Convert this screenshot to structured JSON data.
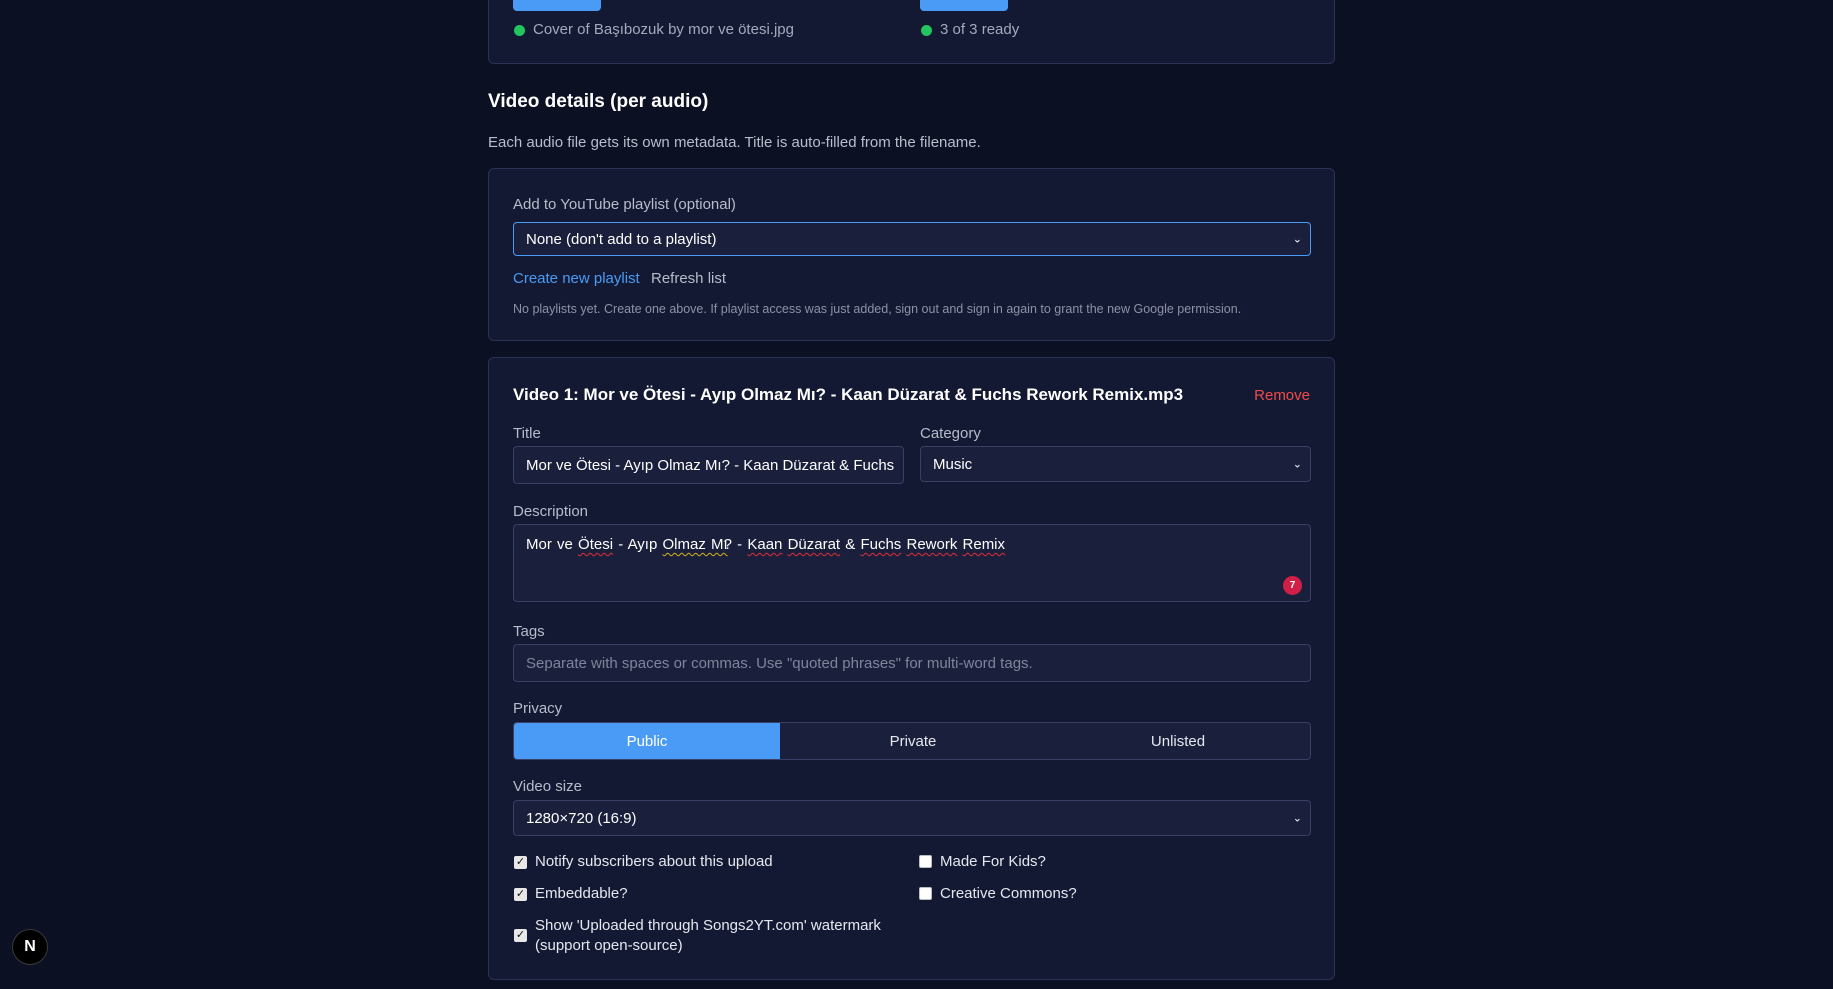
{
  "upload_status": {
    "cover_file": "Cover of Başıbozuk by mor ve ötesi.jpg",
    "ready_text": "3 of 3 ready",
    "status_color": "#22c55e"
  },
  "video_details": {
    "heading": "Video details (per audio)",
    "subtitle": "Each audio file gets its own metadata. Title is auto-filled from the filename."
  },
  "playlist": {
    "label": "Add to YouTube playlist (optional)",
    "selected": "None (don't add to a playlist)",
    "create_link": "Create new playlist",
    "refresh_link": "Refresh list",
    "note": "No playlists yet. Create one above. If playlist access was just added, sign out and sign in again to grant the new Google permission."
  },
  "video": {
    "heading": "Video 1: Mor ve Ötesi - Ayıp Olmaz Mı? - Kaan Düzarat & Fuchs Rework Remix.mp3",
    "remove_label": "Remove",
    "title_label": "Title",
    "title_value": "Mor ve Ötesi - Ayıp Olmaz Mı? - Kaan Düzarat & Fuchs",
    "category_label": "Category",
    "category_value": "Music",
    "description_label": "Description",
    "description_words": [
      "Mor",
      "ve",
      "Ötesi",
      "-",
      "Ayıp",
      "Olmaz Mı",
      "?",
      "-",
      "Kaan",
      "Düzarat",
      "&",
      "Fuchs",
      "Rework",
      "Remix"
    ],
    "spell_badge_count": "7",
    "tags_label": "Tags",
    "tags_placeholder": "Separate with spaces or commas. Use \"quoted phrases\" for multi-word tags.",
    "privacy_label": "Privacy",
    "privacy_options": [
      "Public",
      "Private",
      "Unlisted"
    ],
    "privacy_selected": "Public",
    "video_size_label": "Video size",
    "video_size_value": "1280×720 (16:9)",
    "options": {
      "notify": {
        "label": "Notify subscribers about this upload",
        "checked": true
      },
      "embeddable": {
        "label": "Embeddable?",
        "checked": true
      },
      "watermark": {
        "label_line1": "Show 'Uploaded through Songs2YT.com' watermark",
        "label_line2": "(support open-source)",
        "checked": true
      },
      "made_for_kids": {
        "label": "Made For Kids?",
        "checked": false
      },
      "creative_commons": {
        "label": "Creative Commons?",
        "checked": false
      }
    }
  },
  "colors": {
    "accent": "#4a9bf5",
    "danger": "#ef4b4b",
    "link": "#4a9bf5"
  },
  "floating_badge": {
    "letter": "N"
  }
}
